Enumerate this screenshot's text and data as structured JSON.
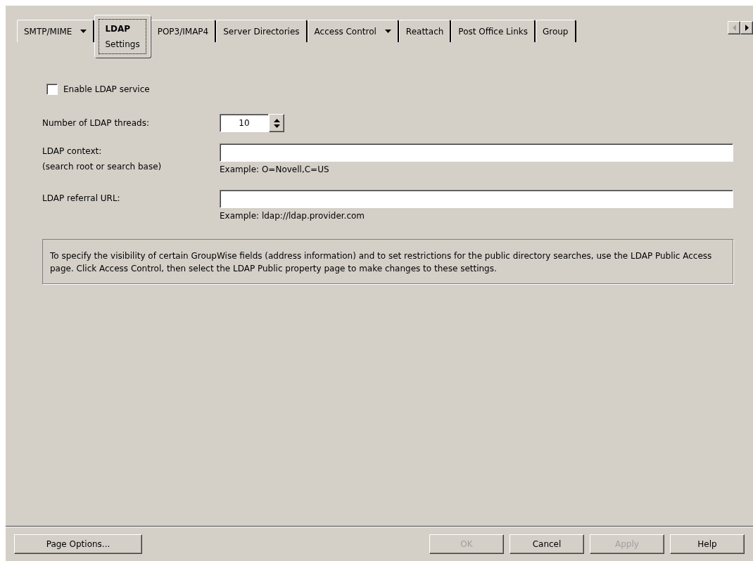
{
  "tabs": [
    {
      "label": "SMTP/MIME",
      "dropdown": true,
      "selected": false
    },
    {
      "label": "LDAP",
      "sublabel": "Settings",
      "dropdown": false,
      "selected": true
    },
    {
      "label": "POP3/IMAP4",
      "dropdown": false,
      "selected": false
    },
    {
      "label": "Server Directories",
      "dropdown": false,
      "selected": false
    },
    {
      "label": "Access Control",
      "dropdown": true,
      "selected": false
    },
    {
      "label": "Reattach",
      "dropdown": false,
      "selected": false
    },
    {
      "label": "Post Office Links",
      "dropdown": false,
      "selected": false
    },
    {
      "label": "Group",
      "dropdown": false,
      "selected": false
    }
  ],
  "enable_ldap": {
    "label": "Enable LDAP service",
    "checked": false
  },
  "threads": {
    "label": "Number of LDAP threads:",
    "value": "10"
  },
  "context": {
    "label": "LDAP context:",
    "sublabel": "(search root or search base)",
    "hint": "Example: O=Novell,C=US"
  },
  "referral": {
    "label": "LDAP referral URL:",
    "hint": "Example: ldap://ldap.provider.com"
  },
  "note": "To specify the visibility of certain GroupWise fields (address information) and to set restrictions for the public directory searches, use the LDAP Public Access page. Click Access Control, then select the LDAP Public property page to make changes to these settings.",
  "page_options": "Page Options...",
  "buttons": [
    {
      "label": "OK",
      "disabled": true
    },
    {
      "label": "Cancel",
      "disabled": false
    },
    {
      "label": "Apply",
      "disabled": true
    },
    {
      "label": "Help",
      "disabled": false
    }
  ]
}
